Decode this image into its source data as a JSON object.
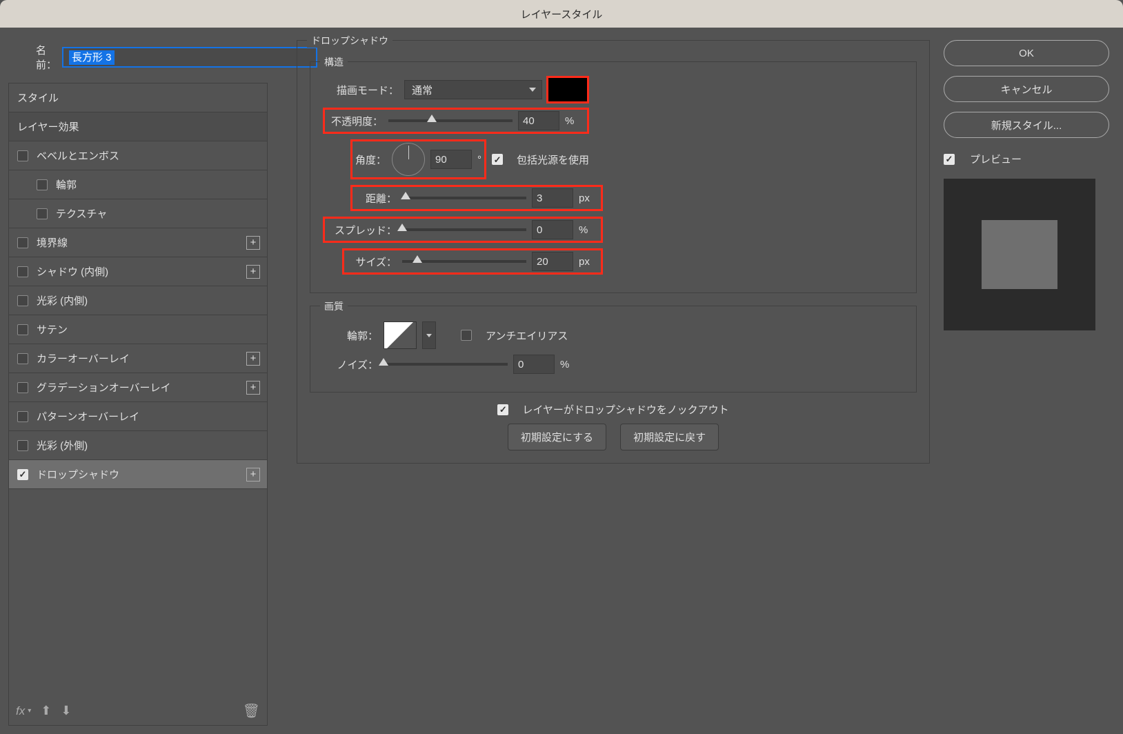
{
  "titlebar": "レイヤースタイル",
  "name": {
    "label": "名前：",
    "value": "長方形 3"
  },
  "styles": {
    "header": "スタイル",
    "subheader": "レイヤー効果",
    "items": [
      {
        "label": "ベベルとエンボス",
        "checked": false,
        "plus": false,
        "indent": false
      },
      {
        "label": "輪郭",
        "checked": false,
        "plus": false,
        "indent": true
      },
      {
        "label": "テクスチャ",
        "checked": false,
        "plus": false,
        "indent": true
      },
      {
        "label": "境界線",
        "checked": false,
        "plus": true,
        "indent": false
      },
      {
        "label": "シャドウ (内側)",
        "checked": false,
        "plus": true,
        "indent": false
      },
      {
        "label": "光彩 (内側)",
        "checked": false,
        "plus": false,
        "indent": false
      },
      {
        "label": "サテン",
        "checked": false,
        "plus": false,
        "indent": false
      },
      {
        "label": "カラーオーバーレイ",
        "checked": false,
        "plus": true,
        "indent": false
      },
      {
        "label": "グラデーションオーバーレイ",
        "checked": false,
        "plus": true,
        "indent": false
      },
      {
        "label": "パターンオーバーレイ",
        "checked": false,
        "plus": false,
        "indent": false
      },
      {
        "label": "光彩 (外側)",
        "checked": false,
        "plus": false,
        "indent": false
      },
      {
        "label": "ドロップシャドウ",
        "checked": true,
        "plus": true,
        "indent": false,
        "selected": true
      }
    ],
    "footer_fx": "fx"
  },
  "panel": {
    "title": "ドロップシャドウ",
    "structure": {
      "title": "構造",
      "blend_label": "描画モード：",
      "blend_value": "通常",
      "color": "#000000",
      "opacity_label": "不透明度：",
      "opacity_value": "40",
      "opacity_unit": "%",
      "angle_label": "角度：",
      "angle_value": "90",
      "angle_unit": "°",
      "global_light_label": "包括光源を使用",
      "distance_label": "距離：",
      "distance_value": "3",
      "distance_unit": "px",
      "spread_label": "スプレッド：",
      "spread_value": "0",
      "spread_unit": "%",
      "size_label": "サイズ：",
      "size_value": "20",
      "size_unit": "px"
    },
    "quality": {
      "title": "画質",
      "contour_label": "輪郭：",
      "antialias_label": "アンチエイリアス",
      "noise_label": "ノイズ：",
      "noise_value": "0",
      "noise_unit": "%"
    },
    "knockout_label": "レイヤーがドロップシャドウをノックアウト",
    "make_default": "初期設定にする",
    "reset_default": "初期設定に戻す"
  },
  "right": {
    "ok": "OK",
    "cancel": "キャンセル",
    "new_style": "新規スタイル...",
    "preview": "プレビュー"
  }
}
